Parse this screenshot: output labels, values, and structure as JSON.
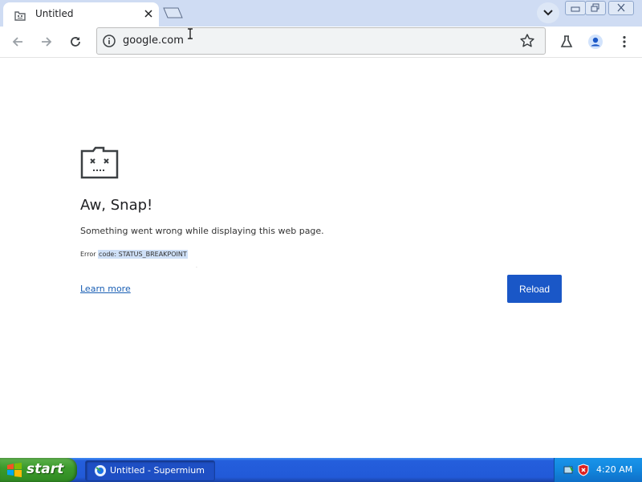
{
  "browser": {
    "tab_title": "Untitled",
    "url": "google.com"
  },
  "page": {
    "heading": "Aw, Snap!",
    "message": "Something went wrong while displaying this web page.",
    "error_prefix": "Error ",
    "error_code": "code: STATUS_BREAKPOINT",
    "learn_more": "Learn more",
    "reload": "Reload"
  },
  "taskbar": {
    "start_label": "start",
    "task_label": "Untitled - Supermium",
    "clock": "4:20 AM"
  },
  "colors": {
    "tabstrip": "#cfdcf3",
    "reload_button": "#1a57c7",
    "link": "#1a5fb4",
    "taskbar": "#245edc",
    "start_button": "#3c9b2c"
  },
  "icons": [
    "sad-tab-icon",
    "close-icon",
    "new-tab-icon",
    "chevron-down-icon",
    "minimize-icon",
    "restore-icon",
    "close-window-icon",
    "back-icon",
    "forward-icon",
    "reload-icon",
    "info-icon",
    "star-icon",
    "labs-icon",
    "profile-icon",
    "menu-icon",
    "windows-flag-icon",
    "browser-icon",
    "shield-icon"
  ]
}
